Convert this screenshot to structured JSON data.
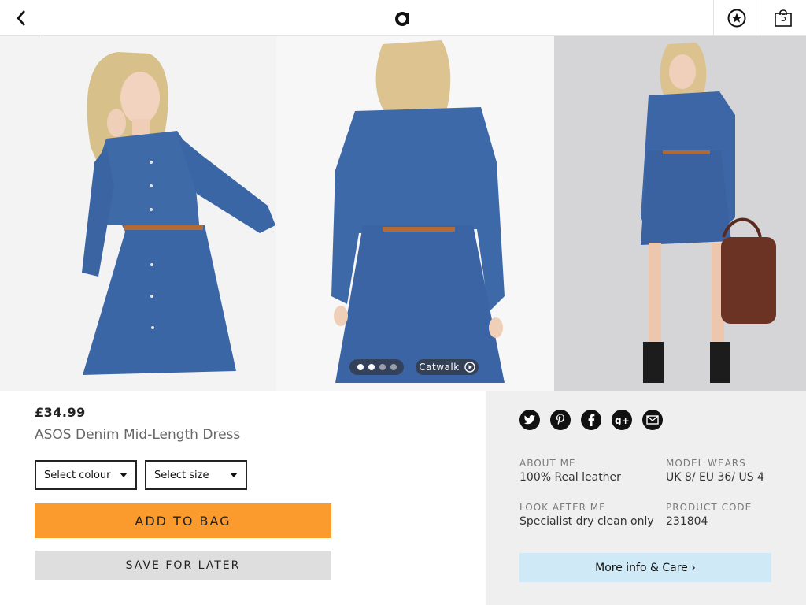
{
  "header": {
    "logo_text": "a",
    "bag_count": "5",
    "icons": [
      "back-chevron-icon",
      "star-circle-icon",
      "shopping-bag-icon"
    ]
  },
  "gallery": {
    "dots_total": 4,
    "dots_active": [
      0,
      1
    ],
    "catwalk_label": "Catwalk"
  },
  "product": {
    "price": "£34.99",
    "title": "ASOS Denim Mid-Length Dress",
    "select_colour": "Select colour",
    "select_size": "Select size",
    "add_to_bag": "ADD TO BAG",
    "save_for_later": "SAVE FOR LATER"
  },
  "info": {
    "social_icons": [
      "twitter-icon",
      "pinterest-icon",
      "facebook-icon",
      "google-plus-icon",
      "email-icon"
    ],
    "about_me_label": "ABOUT ME",
    "about_me_value": "100% Real leather",
    "model_wears_label": "MODEL WEARS",
    "model_wears_value": "UK 8/ EU 36/ US 4",
    "look_after_label": "LOOK AFTER ME",
    "look_after_value": "Specialist dry clean only",
    "product_code_label": "PRODUCT CODE",
    "product_code_value": "231804",
    "more_info": "More info & Care ›"
  },
  "colors": {
    "accent_orange": "#fb9a2d",
    "more_info_blue": "#cfeaf6",
    "denim": "#3e68a8"
  }
}
